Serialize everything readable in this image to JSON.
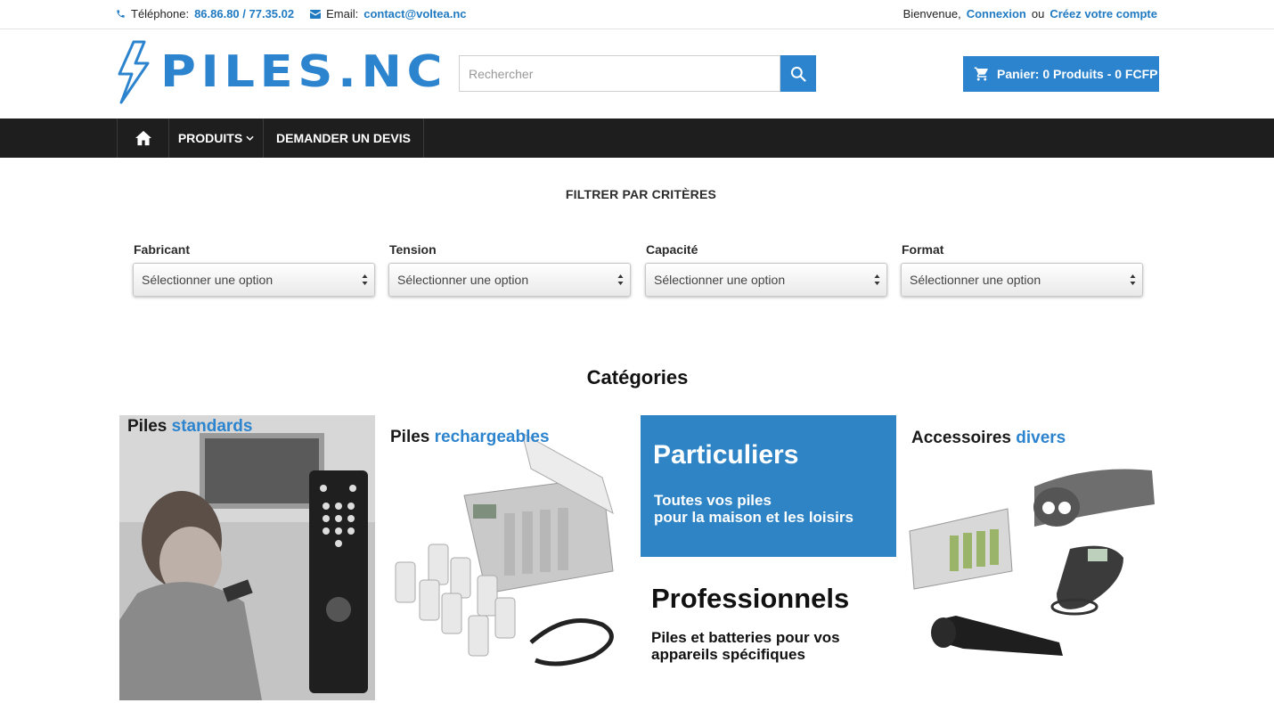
{
  "topbar": {
    "phone_label": "Téléphone:",
    "phone_value": "86.86.80 / 77.35.02",
    "email_label": "Email:",
    "email_value": "contact@voltea.nc",
    "welcome": "Bienvenue,",
    "login": "Connexion",
    "or": "ou",
    "signup": "Créez votre compte"
  },
  "header": {
    "logo_text": "PILES.NC",
    "search_placeholder": "Rechercher",
    "cart_label": "Panier: 0 Produits - 0 FCFP"
  },
  "nav": {
    "products": "PRODUITS",
    "quote": "DEMANDER UN DEVIS"
  },
  "filters": {
    "title": "FILTRER PAR CRITÈRES",
    "groups": [
      {
        "label": "Fabricant",
        "value": "Sélectionner une option"
      },
      {
        "label": "Tension",
        "value": "Sélectionner une option"
      },
      {
        "label": "Capacité",
        "value": "Sélectionner une option"
      },
      {
        "label": "Format",
        "value": "Sélectionner une option"
      }
    ]
  },
  "categories": {
    "title": "Catégories",
    "tiles": [
      {
        "head_a": "Piles",
        "head_b": "standards"
      },
      {
        "head_a": "Piles",
        "head_b": "rechargeables"
      },
      {
        "title_a": "Particuliers",
        "sub_a1": "Toutes vos piles",
        "sub_a2": "pour la maison et les loisirs",
        "title_b": "Professionnels",
        "sub_b1": "Piles et batteries pour vos",
        "sub_b2": "appareils spécifiques"
      },
      {
        "head_a": "Accessoires",
        "head_b": "divers"
      }
    ]
  },
  "colors": {
    "accent": "#2c84ce",
    "nav_bg": "#1e1e1e",
    "link": "#1f7ac2"
  }
}
